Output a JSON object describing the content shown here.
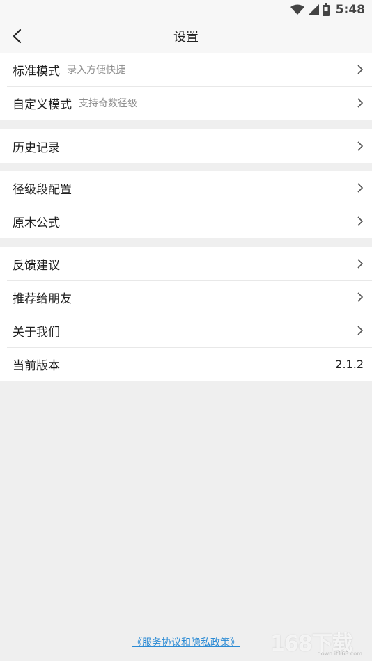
{
  "status_bar": {
    "time": "5:48",
    "icons": [
      "wifi-icon",
      "cell-signal-icon",
      "battery-icon"
    ]
  },
  "header": {
    "title": "设置",
    "back_icon": "back-arrow-icon"
  },
  "groups": [
    {
      "rows": [
        {
          "label": "标准模式",
          "sub": "录入方便快捷",
          "chevron": true
        },
        {
          "label": "自定义模式",
          "sub": "支持奇数径级",
          "chevron": true
        }
      ]
    },
    {
      "rows": [
        {
          "label": "历史记录",
          "chevron": true
        }
      ]
    },
    {
      "rows": [
        {
          "label": "径级段配置",
          "chevron": true
        },
        {
          "label": "原木公式",
          "chevron": true
        }
      ]
    },
    {
      "rows": [
        {
          "label": "反馈建议",
          "chevron": true
        },
        {
          "label": "推荐给朋友",
          "chevron": true
        },
        {
          "label": "关于我们",
          "chevron": true
        },
        {
          "label": "当前版本",
          "value": "2.1.2"
        }
      ]
    }
  ],
  "footer": {
    "link_text": "《服务协议和隐私政策》"
  },
  "watermark": {
    "main": "168下载",
    "sub": "down.it168.com"
  },
  "colors": {
    "background": "#efefef",
    "card": "#ffffff",
    "link": "#2a8ad4"
  }
}
